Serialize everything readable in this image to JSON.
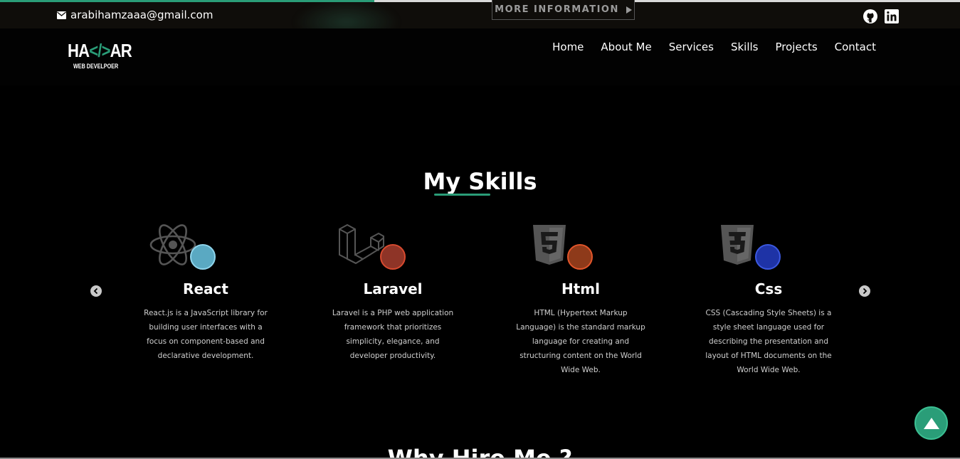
{
  "topbar": {
    "email": "arabihamzaaa@gmail.com",
    "more_info": "MORE INFORMATION",
    "progress": 0.39
  },
  "logo": {
    "main_left": "HA",
    "main_code": "</>",
    "main_right": "AR",
    "subtitle": "WEB DEVELPOER"
  },
  "nav": {
    "items": [
      {
        "label": "Home"
      },
      {
        "label": "About Me"
      },
      {
        "label": "Services"
      },
      {
        "label": "Skills"
      },
      {
        "label": "Projects"
      },
      {
        "label": "Contact"
      }
    ]
  },
  "skills_section": {
    "title": "My Skills",
    "cards": [
      {
        "name": "React",
        "icon": "react-icon",
        "dot_color": "#5aa9c2",
        "desc": "React.js is a JavaScript library for building user interfaces with a focus on component-based and declarative development."
      },
      {
        "name": "Laravel",
        "icon": "laravel-icon",
        "dot_color": "#8e3427",
        "desc": "Laravel is a PHP web application framework that prioritizes simplicity, elegance, and developer productivity."
      },
      {
        "name": "Html",
        "icon": "html5-icon",
        "dot_color": "#8e3a1a",
        "desc": "HTML (Hypertext Markup Language) is the standard markup language for creating and structuring content on the World Wide Web."
      },
      {
        "name": "Css",
        "icon": "css3-icon",
        "dot_color": "#1e33a6",
        "desc": "CSS (Cascading Style Sheets) is a style sheet language used for describing the presentation and layout of HTML documents on the World Wide Web."
      }
    ]
  },
  "next_section": {
    "title": "Why Hire Me ?"
  },
  "colors": {
    "accent": "#2a9d78",
    "background": "#000000"
  }
}
